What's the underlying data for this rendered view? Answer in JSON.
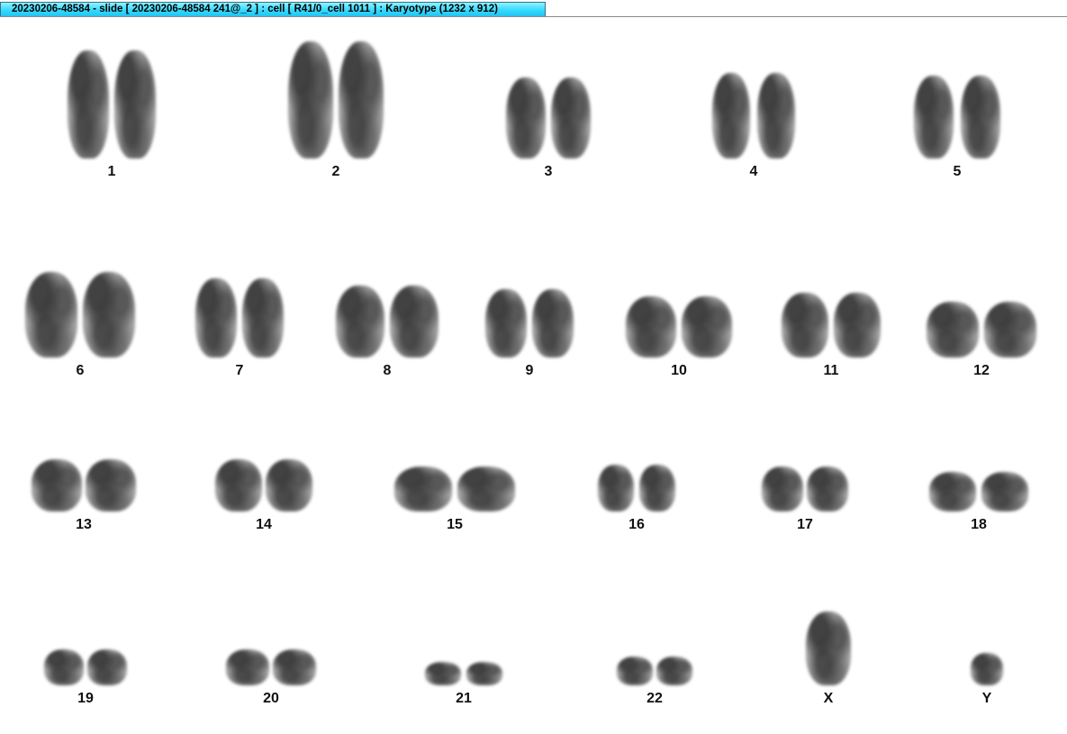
{
  "window": {
    "title": "20230206-48584 - slide [ 20230206-48584 241@_2 ] : cell [ R41/0_cell 1011 ] : Karyotype  (1232 x 912)"
  },
  "karyotype": {
    "chromosomes": [
      {
        "label": "1"
      },
      {
        "label": "2"
      },
      {
        "label": "3"
      },
      {
        "label": "4"
      },
      {
        "label": "5"
      },
      {
        "label": "6"
      },
      {
        "label": "7"
      },
      {
        "label": "8"
      },
      {
        "label": "9"
      },
      {
        "label": "10"
      },
      {
        "label": "11"
      },
      {
        "label": "12"
      },
      {
        "label": "13"
      },
      {
        "label": "14"
      },
      {
        "label": "15"
      },
      {
        "label": "16"
      },
      {
        "label": "17"
      },
      {
        "label": "18"
      },
      {
        "label": "19"
      },
      {
        "label": "20"
      },
      {
        "label": "21"
      },
      {
        "label": "22"
      },
      {
        "label": "X"
      },
      {
        "label": "Y"
      }
    ]
  },
  "colors": {
    "title_tab": "#37d9ff",
    "chromosome": "#555555",
    "label": "#111111"
  }
}
